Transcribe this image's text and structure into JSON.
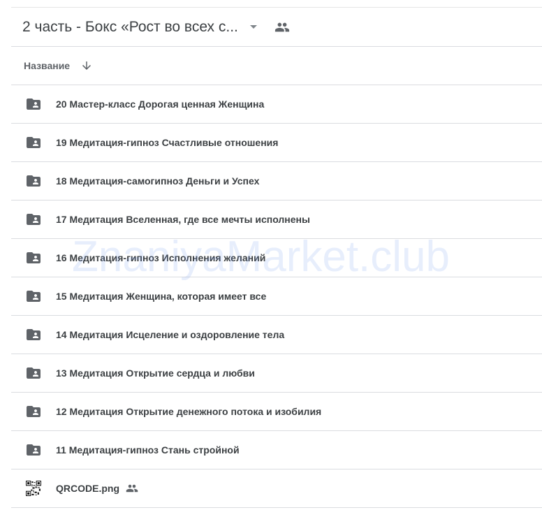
{
  "header": {
    "folder_title": "2 часть - Бокс «Рост во всех с...",
    "dropdown_icon": "dropdown-arrow-icon",
    "shared_icon": "people-icon"
  },
  "columns": {
    "name_label": "Название",
    "sort_icon": "arrow-down-icon"
  },
  "files": [
    {
      "name": "20 Мастер-класс Дорогая ценная Женщина",
      "icon": "shared-folder-icon",
      "type": "folder",
      "shared": false
    },
    {
      "name": "19 Медитация-гипноз Счастливые отношения",
      "icon": "shared-folder-icon",
      "type": "folder",
      "shared": false
    },
    {
      "name": "18 Медитация-самогипноз Деньги и Успех",
      "icon": "shared-folder-icon",
      "type": "folder",
      "shared": false
    },
    {
      "name": "17 Медитация Вселенная, где все мечты исполнены",
      "icon": "shared-folder-icon",
      "type": "folder",
      "shared": false
    },
    {
      "name": "16 Медитация-гипноз Исполнения желаний",
      "icon": "shared-folder-icon",
      "type": "folder",
      "shared": false
    },
    {
      "name": "15 Медитация Женщина, которая имеет все",
      "icon": "shared-folder-icon",
      "type": "folder",
      "shared": false
    },
    {
      "name": "14 Медитация Исцеление и оздоровление тела",
      "icon": "shared-folder-icon",
      "type": "folder",
      "shared": false
    },
    {
      "name": "13 Медитация Открытие сердца и любви",
      "icon": "shared-folder-icon",
      "type": "folder",
      "shared": false
    },
    {
      "name": "12 Медитация Открытие денежного потока и изобилия",
      "icon": "shared-folder-icon",
      "type": "folder",
      "shared": false
    },
    {
      "name": "11 Медитация-гипноз Стань стройной",
      "icon": "shared-folder-icon",
      "type": "folder",
      "shared": false
    },
    {
      "name": "QRCODE.png",
      "icon": "qr-code-icon",
      "type": "image",
      "shared": true
    }
  ],
  "watermark": "ZnaniyaMarket.club",
  "colors": {
    "text": "#3c4043",
    "secondary_text": "#5f6368",
    "icon": "#5f6368",
    "divider": "#dadce0",
    "watermark": "#6796ee"
  }
}
